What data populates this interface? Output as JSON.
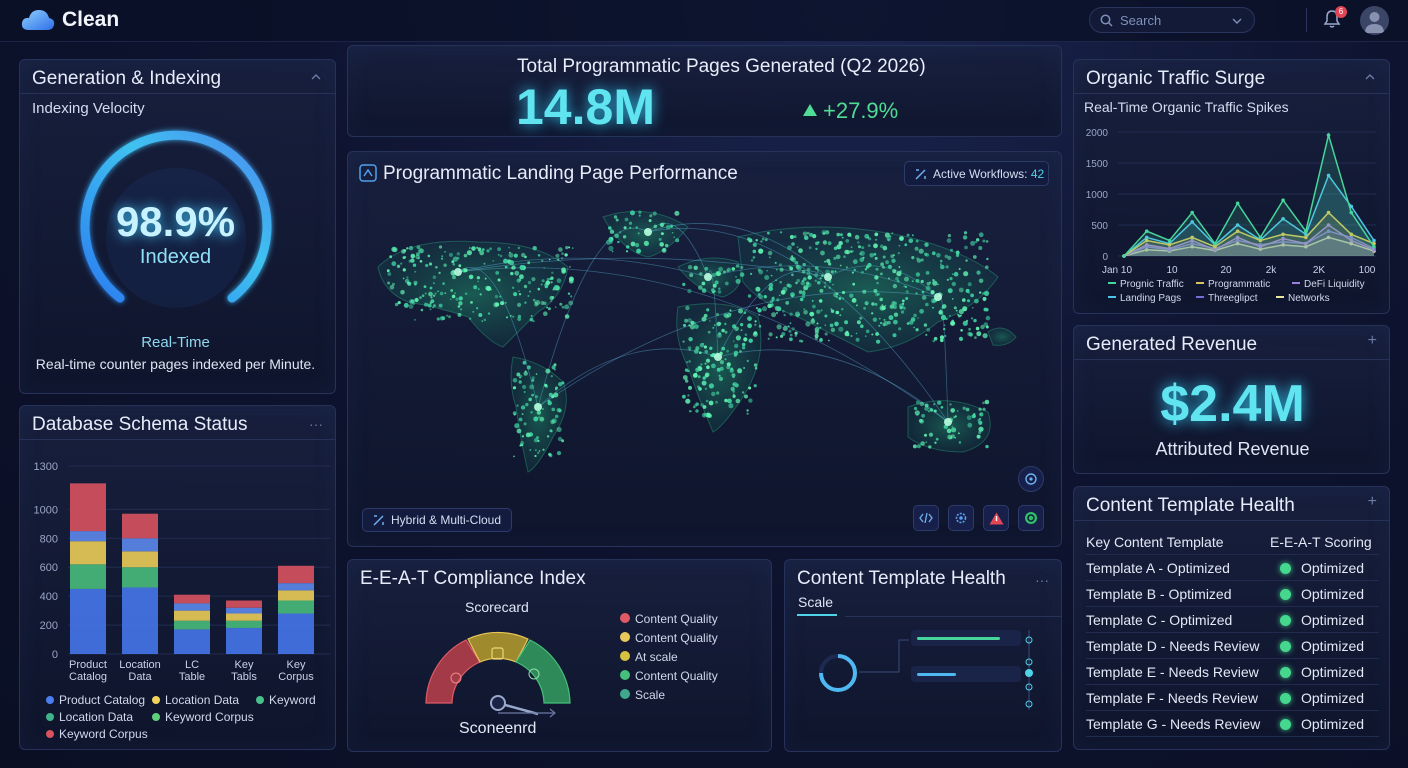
{
  "app": {
    "name": "Clean"
  },
  "topbar": {
    "search_placeholder": "Search",
    "notification_count": "6"
  },
  "indexing": {
    "title": "Generation & Indexing",
    "subtitle": "Indexing Velocity",
    "value": "98.9%",
    "value_label": "Indexed",
    "progress": 0.989,
    "realtime_label": "Real-Time",
    "caption": "Real-time counter pages indexed per Minute."
  },
  "schema": {
    "title": "Database Schema Status",
    "legend": [
      {
        "label": "Product Catalog",
        "color": "#4b7ff0"
      },
      {
        "label": "Location Data",
        "color": "#f0d35a"
      },
      {
        "label": "Keyword",
        "color": "#49c08c"
      },
      {
        "label": "Location Data",
        "color": "#3fb48a"
      },
      {
        "label": "Keyword Corpus",
        "color": "#5fd07a"
      },
      {
        "label": "Keyword Corpus",
        "color": "#d9535f"
      }
    ]
  },
  "chart_data": [
    {
      "type": "bar",
      "stacked": true,
      "categories": [
        "Product Catalog",
        "Location Data",
        "LC Table",
        "Key Tabls",
        "Key Corpus"
      ],
      "category_labels": [
        [
          "Product",
          "Catalog"
        ],
        [
          "Location",
          "Data"
        ],
        [
          "LC",
          "Table"
        ],
        [
          "Key",
          "Tabls"
        ],
        [
          "Key",
          "Corpus"
        ]
      ],
      "yticks": [
        0,
        200,
        400,
        600,
        800,
        1000,
        1300
      ],
      "segment_colors": [
        "#4474e6",
        "#46b87a",
        "#e7c857",
        "#5b86e8",
        "#d4505e"
      ],
      "series": [
        {
          "values": [
            450,
            460,
            170,
            180,
            280
          ]
        },
        {
          "values": [
            170,
            140,
            60,
            50,
            90
          ]
        },
        {
          "values": [
            160,
            110,
            70,
            50,
            70
          ]
        },
        {
          "values": [
            70,
            90,
            50,
            40,
            50
          ]
        },
        {
          "values": [
            330,
            170,
            60,
            50,
            120
          ]
        }
      ]
    },
    {
      "type": "line",
      "title": "Real-Time Organic Traffic Spikes",
      "x_labels": [
        "Jan 10",
        "10",
        "20",
        "2k",
        "2K",
        "100"
      ],
      "yticks": [
        0,
        500,
        1000,
        1500,
        2000
      ],
      "ylim": [
        0,
        2000
      ],
      "series": [
        {
          "name": "Prognic Traffic",
          "color": "#46d59a",
          "values": [
            0,
            400,
            250,
            700,
            200,
            850,
            300,
            900,
            400,
            1950,
            700,
            150
          ]
        },
        {
          "name": "Programmatic",
          "color": "#d6c75a",
          "values": [
            0,
            250,
            180,
            300,
            150,
            400,
            250,
            350,
            300,
            700,
            350,
            200
          ]
        },
        {
          "name": "DeFi Liquidity",
          "color": "#9b7fe0",
          "values": [
            0,
            180,
            120,
            250,
            100,
            300,
            150,
            280,
            200,
            500,
            250,
            100
          ]
        },
        {
          "name": "Landing Pags",
          "color": "#4fc6e8",
          "values": [
            0,
            300,
            200,
            550,
            180,
            500,
            260,
            600,
            350,
            1300,
            800,
            250
          ]
        },
        {
          "name": "Threeglipct",
          "color": "#7a6cd8",
          "values": [
            0,
            150,
            100,
            200,
            120,
            250,
            180,
            230,
            200,
            400,
            300,
            120
          ]
        },
        {
          "name": "Networks",
          "color": "#e6e6a0",
          "values": [
            0,
            100,
            80,
            150,
            90,
            200,
            110,
            180,
            150,
            300,
            200,
            80
          ]
        }
      ]
    }
  ],
  "total": {
    "title": "Total Programmatic Pages Generated (Q2 2026)",
    "value": "14.8M",
    "change": "+27.9%"
  },
  "map": {
    "title": "Programmatic Landing Page Performance",
    "workflows_label": "Active Workflows:",
    "workflows_value": "42",
    "cloud_label": "Hybrid & Multi-Cloud"
  },
  "eeat": {
    "title": "E-E-A-T Compliance Index",
    "scorecard_label": "Scorecard",
    "bottom_label": "Sconeenrd",
    "legend": [
      {
        "label": "Content Quality",
        "color": "#e05a66"
      },
      {
        "label": "Content Quality",
        "color": "#e8c85a"
      },
      {
        "label": "At scale",
        "color": "#d8c040"
      },
      {
        "label": "Content Quality",
        "color": "#44c07a"
      },
      {
        "label": "Scale",
        "color": "#3fa88c"
      }
    ]
  },
  "template_mini": {
    "title": "Content Template Health",
    "tab": "Scale",
    "bars": [
      0.85,
      0.4
    ]
  },
  "traffic": {
    "title": "Organic Traffic Surge",
    "subtitle": "Real-Time Organic Traffic Spikes",
    "legend": [
      {
        "label": "Prognic Traffic",
        "color": "#46d59a"
      },
      {
        "label": "Programmatic",
        "color": "#d6c75a"
      },
      {
        "label": "DeFi Liquidity",
        "color": "#9b7fe0"
      },
      {
        "label": "Landing Pags",
        "color": "#4fc6e8"
      },
      {
        "label": "Threeglipct",
        "color": "#7a6cd8"
      },
      {
        "label": "Networks",
        "color": "#e6e6a0"
      }
    ]
  },
  "revenue": {
    "title": "Generated Revenue",
    "value": "$2.4M",
    "label": "Attributed Revenue"
  },
  "health": {
    "title": "Content Template Health",
    "col1": "Key Content Template",
    "col2": "E-E-A-T Scoring",
    "rows": [
      {
        "name": "Template A - Optimized",
        "status": "Optimized"
      },
      {
        "name": "Template B - Optimized",
        "status": "Optimized"
      },
      {
        "name": "Template C - Optimized",
        "status": "Optimized"
      },
      {
        "name": "Template D - Needs Review",
        "status": "Optimized"
      },
      {
        "name": "Template E - Needs Review",
        "status": "Optimized"
      },
      {
        "name": "Template F - Needs Review",
        "status": "Optimized"
      },
      {
        "name": "Template G - Needs Review",
        "status": "Optimized"
      }
    ]
  }
}
